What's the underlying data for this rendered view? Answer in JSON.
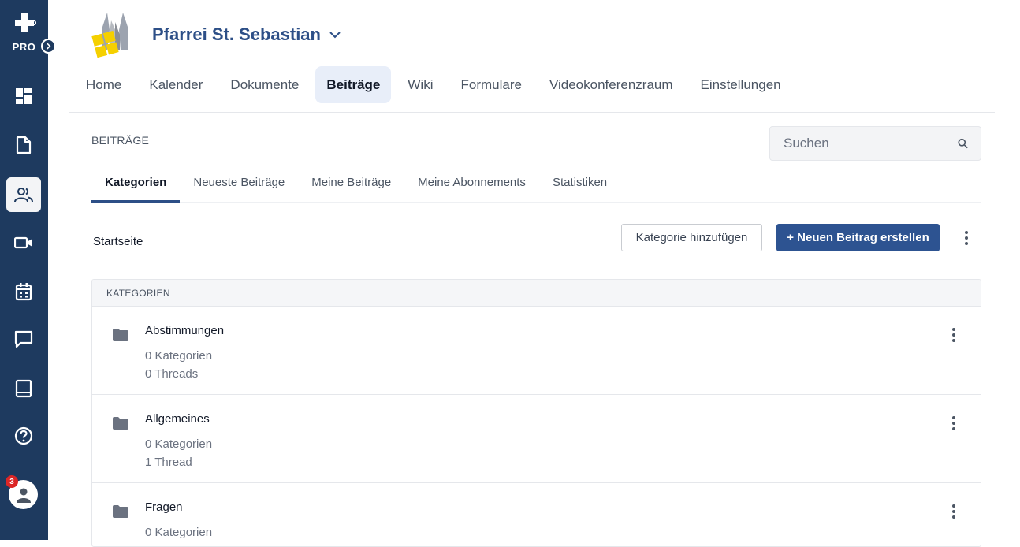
{
  "rail": {
    "pro_label": "PRO",
    "items": [
      "dashboard-icon",
      "document-icon",
      "users-icon",
      "video-icon",
      "calendar-icon",
      "chat-icon",
      "book-icon",
      "help-icon"
    ],
    "active_item": "users-icon",
    "notification_count": "3"
  },
  "header": {
    "org_name": "Pfarrei St. Sebastian"
  },
  "mainnav": {
    "items": [
      "Home",
      "Kalender",
      "Dokumente",
      "Beiträge",
      "Wiki",
      "Formulare",
      "Videokonferenzraum",
      "Einstellungen"
    ],
    "active": "Beiträge"
  },
  "section": {
    "title": "BEITRÄGE",
    "search_placeholder": "Suchen"
  },
  "subtabs": {
    "items": [
      "Kategorien",
      "Neueste Beiträge",
      "Meine Beiträge",
      "Meine Abonnements",
      "Statistiken"
    ],
    "active": "Kategorien"
  },
  "toolbar": {
    "breadcrumb": "Startseite",
    "add_category_label": "Kategorie hinzufügen",
    "new_post_label": "+ Neuen Beitrag erstellen"
  },
  "categories": {
    "header": "KATEGORIEN",
    "rows": [
      {
        "name": "Abstimmungen",
        "subcategories": "0 Kategorien",
        "threads": "0 Threads"
      },
      {
        "name": "Allgemeines",
        "subcategories": "0 Kategorien",
        "threads": "1 Thread"
      },
      {
        "name": "Fragen",
        "subcategories": "0 Kategorien",
        "threads": ""
      }
    ]
  },
  "colors": {
    "rail": "#1e3a5f",
    "brand": "#2d4f87",
    "primary_button": "#2d5391",
    "badge": "#dc2626"
  }
}
